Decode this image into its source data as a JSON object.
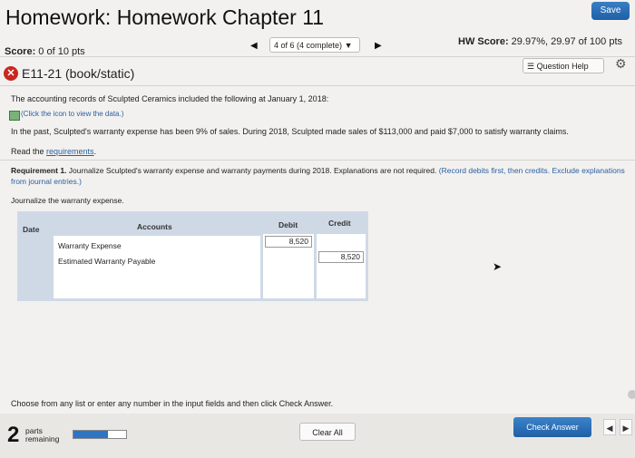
{
  "header": {
    "title": "Homework: Homework Chapter 11",
    "save_label": "Save",
    "score_label": "Score:",
    "score_value": " 0 of 10 pts",
    "nav_prev_icon": "left-triangle-icon",
    "nav_select_value": "4 of 6 (4 complete)",
    "nav_next_icon": "right-triangle-icon",
    "hw_score_label": "HW Score:",
    "hw_score_value": " 29.97%, 29.97 of 100 pts"
  },
  "problem": {
    "id": "E11-21 (book/static)",
    "question_help_label": "Question Help",
    "intro": "The accounting records of Sculpted Ceramics included the following at January 1, 2018:",
    "data_link": "(Click the icon to view the data.)",
    "detail": "In the past, Sculpted's warranty expense has been 9% of sales. During 2018, Sculpted made sales of $113,000 and paid $7,000 to satisfy warranty claims.",
    "read_prefix": "Read the ",
    "read_link": "requirements",
    "read_suffix": ".",
    "req_bold": "Requirement 1.",
    "req_text": " Journalize Sculpted's warranty expense and warranty payments during 2018. Explanations are not required.",
    "req_note": " (Record debits first, then credits. Exclude explanations from journal entries.)",
    "journalize_label": "Journalize the warranty expense."
  },
  "journal": {
    "headers": {
      "date": "Date",
      "accounts": "Accounts",
      "debit": "Debit",
      "credit": "Credit"
    },
    "rows": [
      {
        "account": "Warranty Expense",
        "debit": "8,520",
        "credit": ""
      },
      {
        "account": "Estimated Warranty Payable",
        "debit": "",
        "credit": "8,520"
      }
    ]
  },
  "footer": {
    "instruction": "Choose from any list or enter any number in the input fields and then click Check Answer.",
    "parts_number": "2",
    "parts_label_1": "parts",
    "parts_label_2": "remaining",
    "progress_fraction": 0.65,
    "clear_label": "Clear All",
    "check_label": "Check Answer"
  },
  "colors": {
    "accent": "#2c74c4",
    "error": "#c8281e",
    "table_bg": "#cfd9e6"
  }
}
